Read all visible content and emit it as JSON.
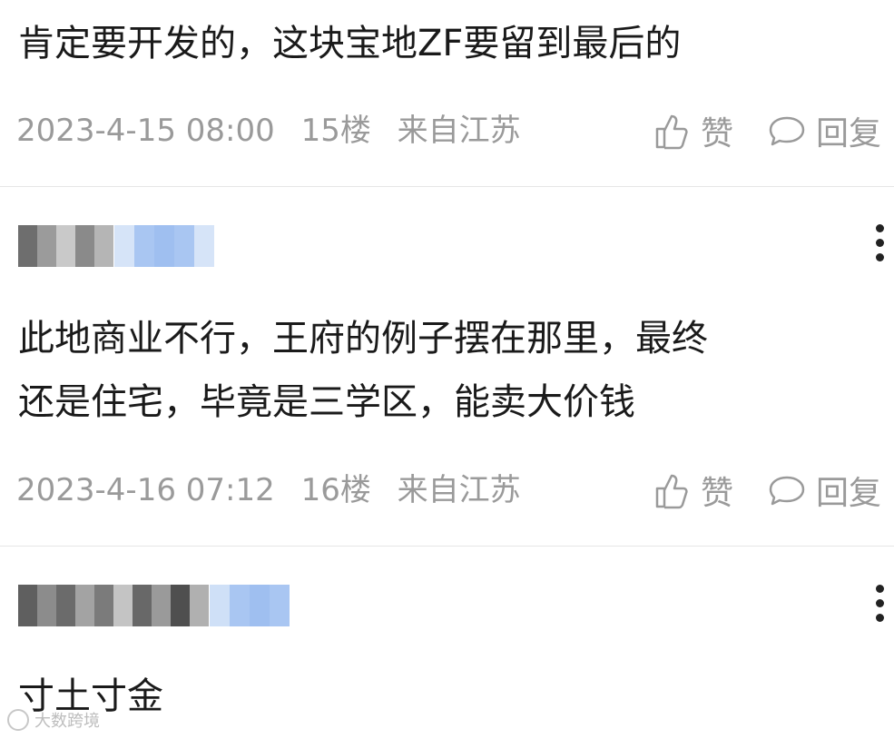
{
  "comments": [
    {
      "text_lines": [
        "肯定要开发的，这块宝地ZF要留到最后的"
      ],
      "time": "2023-4-15 08:00",
      "floor": "15楼",
      "location": "来自江苏",
      "like_label": "赞",
      "reply_label": "回复"
    },
    {
      "text_lines": [
        "此地商业不行，王府的例子摆在那里，最终",
        "还是住宅，毕竟是三学区，能卖大价钱"
      ],
      "time": "2023-4-16 07:12",
      "floor": "16楼",
      "location": "来自江苏",
      "like_label": "赞",
      "reply_label": "回复"
    },
    {
      "text_lines": [
        "寸土寸金"
      ]
    }
  ],
  "icons": {
    "like": "thumbs-up-icon",
    "reply": "speech-bubble-icon",
    "more": "vertical-ellipsis-icon"
  },
  "watermark": {
    "text": "大数跨境"
  },
  "colors": {
    "meta": "#9a9a9a",
    "text": "#1a1a1a",
    "badge": "#a9c6f2",
    "divider": "#e6e6e6"
  }
}
